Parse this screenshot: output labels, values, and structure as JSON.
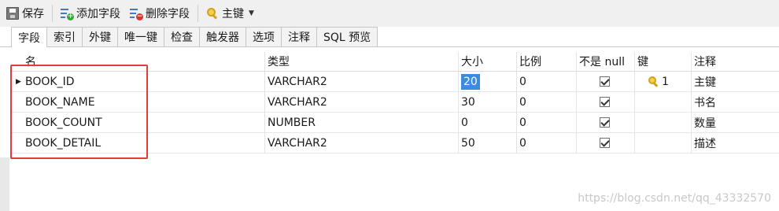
{
  "toolbar": {
    "save_label": "保存",
    "add_field_label": "添加字段",
    "delete_field_label": "删除字段",
    "primary_key_label": "主键"
  },
  "tabs": [
    "字段",
    "索引",
    "外键",
    "唯一键",
    "检查",
    "触发器",
    "选项",
    "注释",
    "SQL 预览"
  ],
  "grid": {
    "columns": [
      "名",
      "类型",
      "大小",
      "比例",
      "不是 null",
      "键",
      "注释"
    ],
    "rows": [
      {
        "name": "BOOK_ID",
        "type": "VARCHAR2",
        "size": "20",
        "scale": "0",
        "not_null": true,
        "key": "1",
        "comment": "主键"
      },
      {
        "name": "BOOK_NAME",
        "type": "VARCHAR2",
        "size": "30",
        "scale": "0",
        "not_null": true,
        "key": "",
        "comment": "书名"
      },
      {
        "name": "BOOK_COUNT",
        "type": "NUMBER",
        "size": "0",
        "scale": "0",
        "not_null": true,
        "key": "",
        "comment": "数量"
      },
      {
        "name": "BOOK_DETAIL",
        "type": "VARCHAR2",
        "size": "50",
        "scale": "0",
        "not_null": true,
        "key": "",
        "comment": "描述"
      }
    ]
  },
  "watermark": "https://blog.csdn.net/qq_43332570",
  "colors": {
    "highlight_box": "#e23b3b",
    "selection": "#3d8bdf",
    "key_gold": "#d4a017"
  }
}
